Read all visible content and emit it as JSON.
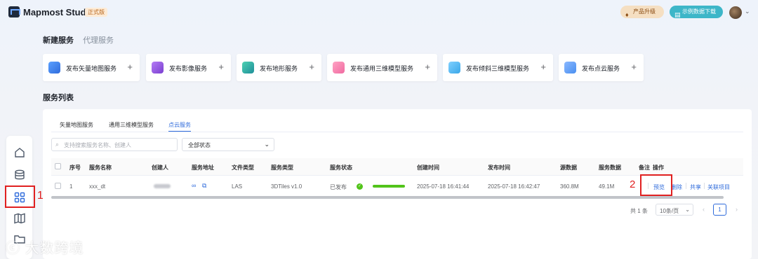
{
  "header": {
    "app_name": "Mapmost Studio",
    "edition": "正式版",
    "upgrade_label": "产品升级",
    "download_label": "示例数据下载"
  },
  "top_tabs": [
    "新建服务",
    "代理服务"
  ],
  "service_cards": [
    {
      "label": "发布矢量地图服务",
      "icon": "globe-icon",
      "color": "#3a7bd5"
    },
    {
      "label": "发布影像服务",
      "icon": "image-service-icon",
      "color": "#8a4fd8"
    },
    {
      "label": "发布地形服务",
      "icon": "terrain-icon",
      "color": "#2bb3a0"
    },
    {
      "label": "发布通用三维模型服务",
      "icon": "cube-icon",
      "color": "#f06aa0"
    },
    {
      "label": "发布倾斜三维模型服务",
      "icon": "tilt-model-icon",
      "color": "#3aa6e8"
    },
    {
      "label": "发布点云服务",
      "icon": "cloud-icon",
      "color": "#4a8ff0"
    }
  ],
  "section_title": "服务列表",
  "sub_tabs": [
    "矢量地图服务",
    "通用三维模型服务",
    "点云服务"
  ],
  "active_sub_tab": "点云服务",
  "search": {
    "placeholder": "支持搜索服务名称、创建人"
  },
  "status_filter": "全部状态",
  "table": {
    "headers": [
      "序号",
      "服务名称",
      "创建人",
      "服务地址",
      "文件类型",
      "服务类型",
      "服务状态",
      "创建时间",
      "发布时间",
      "源数据",
      "服务数据",
      "备注",
      "操作"
    ],
    "rows": [
      {
        "index": "1",
        "name": "xxx_dt",
        "file_type": "LAS",
        "service_type": "3DTiles v1.0",
        "status": "已发布",
        "progress": 1.0,
        "created": "2025-07-18 16:41:44",
        "published": "2025-07-18 16:42:47",
        "source_size": "360.8M",
        "service_size": "49.1M",
        "actions": [
          "预览",
          "删除",
          "共享",
          "关联项目"
        ]
      }
    ]
  },
  "pagination": {
    "total": "共 1 条",
    "page_size": "10条/页",
    "current_page": "1"
  },
  "annotations": {
    "one": "1",
    "two": "2"
  },
  "watermark": "大数跨境",
  "colors": {
    "accent": "#2f6bdb",
    "highlight": "#e02020",
    "success": "#52c41a"
  }
}
